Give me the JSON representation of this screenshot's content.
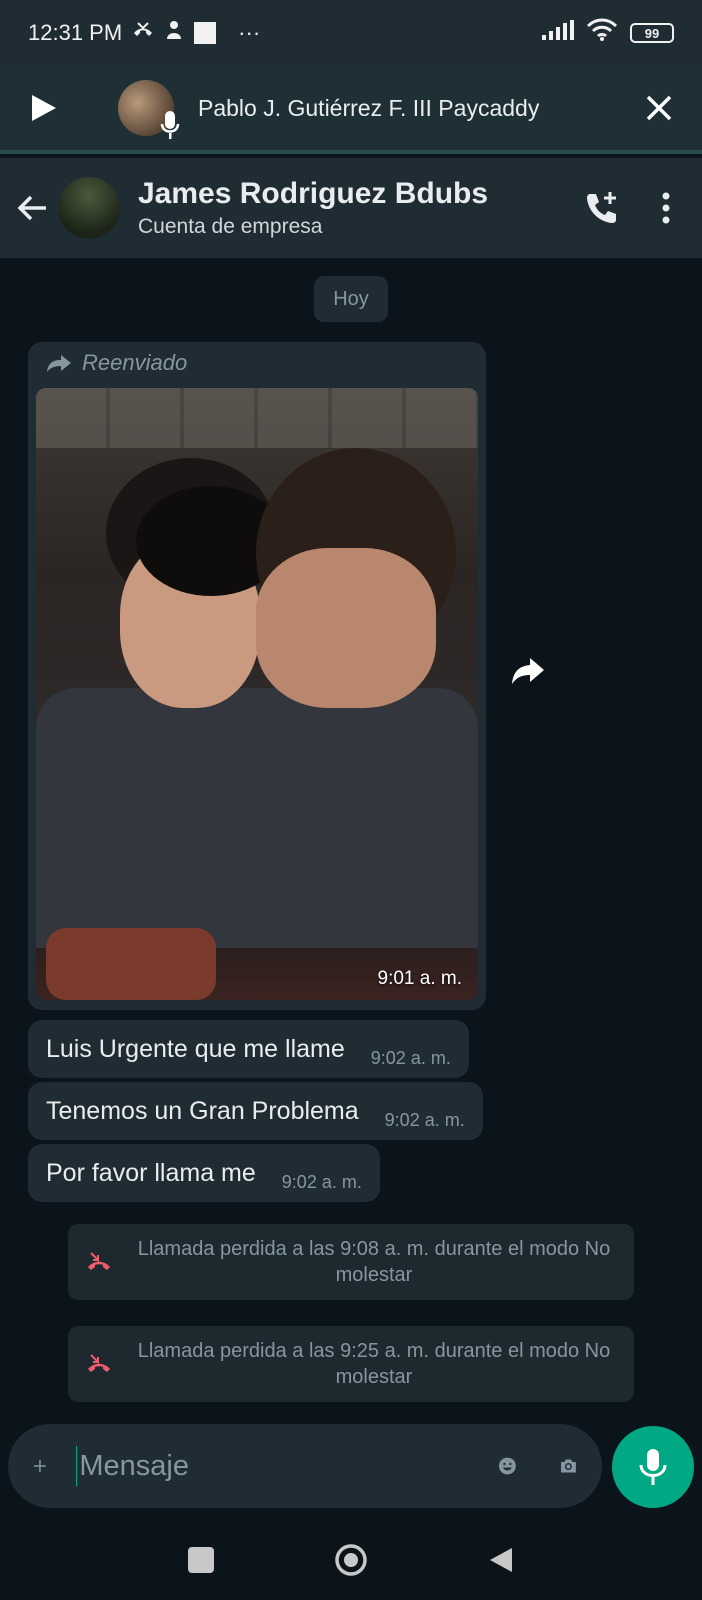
{
  "status_bar": {
    "time": "12:31 PM",
    "more_indicator": "···",
    "battery": "99",
    "icons": [
      "missed-call-icon",
      "notification-icon",
      "square-icon",
      "signal-icon",
      "wifi-icon",
      "battery-icon"
    ]
  },
  "audio_player": {
    "title": "Pablo J. Gutiérrez F. III Paycaddy"
  },
  "chat_header": {
    "name": "James Rodriguez Bdubs",
    "subtitle": "Cuenta de empresa"
  },
  "chat": {
    "date_label": "Hoy",
    "forwarded_label": "Reenviado",
    "photo_time": "9:01 a. m.",
    "messages": [
      {
        "text": "Luis Urgente que me llame",
        "time": "9:02 a. m."
      },
      {
        "text": "Tenemos un Gran Problema",
        "time": "9:02 a. m."
      },
      {
        "text": "Por favor llama me",
        "time": "9:02 a. m."
      }
    ],
    "missed_calls": [
      {
        "text": "Llamada perdida a las 9:08 a. m. durante el modo No molestar"
      },
      {
        "text": "Llamada perdida a las 9:25 a. m. durante el modo No molestar"
      }
    ]
  },
  "composer": {
    "placeholder": "Mensaje"
  },
  "colors": {
    "accent": "#00a884",
    "bubble": "#202c33",
    "background": "#0b141a",
    "missed_call": "#f15c6d"
  }
}
